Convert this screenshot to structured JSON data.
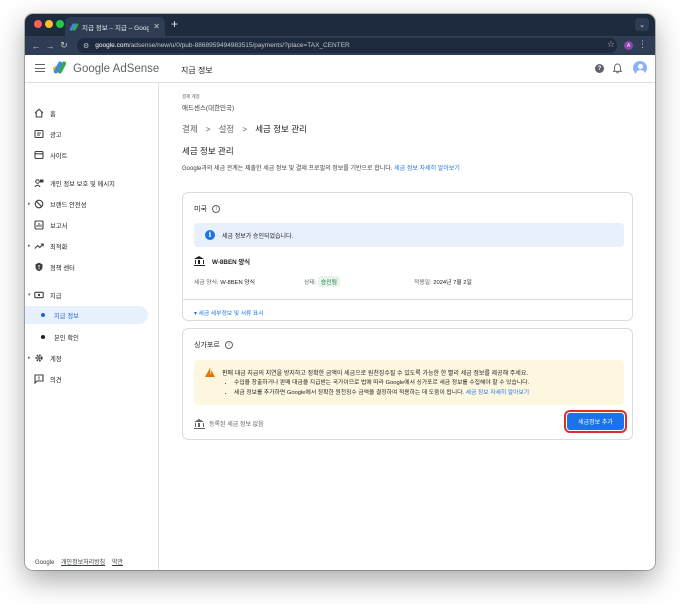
{
  "browser": {
    "tab_title": "지급 정보 – 지급 – Google AdSense",
    "tab_close": "✕",
    "new_tab": "+",
    "url_host": "google.com",
    "url_path": "/adsense/new/u/0/pub-8868959494983515/payments/?place=TAX_CENTER",
    "profile_initial": "A"
  },
  "header": {
    "brand": "Google AdSense",
    "page_title": "지급 정보"
  },
  "sidebar": {
    "items": [
      {
        "label": "홈"
      },
      {
        "label": "광고"
      },
      {
        "label": "사이트"
      },
      {
        "label": "개인 정보 보호 및 메시지"
      },
      {
        "label": "브랜드 안전성"
      },
      {
        "label": "보고서"
      },
      {
        "label": "최적화"
      },
      {
        "label": "정책 센터"
      },
      {
        "label": "지급"
      },
      {
        "label": "지급 정보"
      },
      {
        "label": "본인 확인"
      },
      {
        "label": "계정"
      },
      {
        "label": "의견"
      }
    ],
    "footer": {
      "google": "Google",
      "privacy": "개인정보처리방침",
      "terms": "약관"
    }
  },
  "main": {
    "account_label": "결제 계정",
    "account_name": "애드센스(대한민국)",
    "breadcrumb": [
      "결제",
      "설정",
      "세금 정보 관리"
    ],
    "breadcrumb_sep": ">",
    "section_title": "세금 정보 관리",
    "description": "Google과의 세금 관계는 제출한 세금 정보 및 결제 프로필의 정보를 기반으로 합니다.",
    "description_link": "세금 정보 자세히 알아보기",
    "us_card": {
      "title": "미국",
      "banner": "세금 정보가 승인되었습니다.",
      "form_name": "W-8BEN 양식",
      "tax_form_label": "세금 양식:",
      "tax_form_value": "W-8BEN 양식",
      "status_label": "상태:",
      "status_value": "승인됨",
      "effective_label": "적용일:",
      "effective_value": "2024년 7월 2일",
      "details_link": "세금 세부정보 및 서류 표시"
    },
    "sg_card": {
      "title": "싱가포르",
      "warning_main": "판매 대금 지급의 지연을 방지하고 정확한 금액이 세금으로 원천징수될 수 있도록 가능한 한 빨리 세금 정보를 제공해 주세요.",
      "warning_bullets": [
        "수입을 창출하거나 판매 대금을 지급받는 국가이므로 법에 따라 Google에서 싱가포르 세금 정보를 수집해야 할 수 있습니다.",
        "세금 정보를 추가하면 Google에서 정확한 원천징수 금액을 결정하여 적용하는 데 도움이 됩니다."
      ],
      "warning_link": "세금 정보 자세히 알아보기",
      "no_info": "등록된 세금 정보 없음",
      "add_button": "세금정보 추가"
    }
  },
  "colors": {
    "accent": "#1a73e8",
    "active_nav_bg": "#e8f0fe",
    "warning_bg": "#fef7e0",
    "warning_icon": "#e37400",
    "success_bg": "#e6f4ea",
    "success_text": "#137333",
    "highlight_outline": "#d93025"
  }
}
